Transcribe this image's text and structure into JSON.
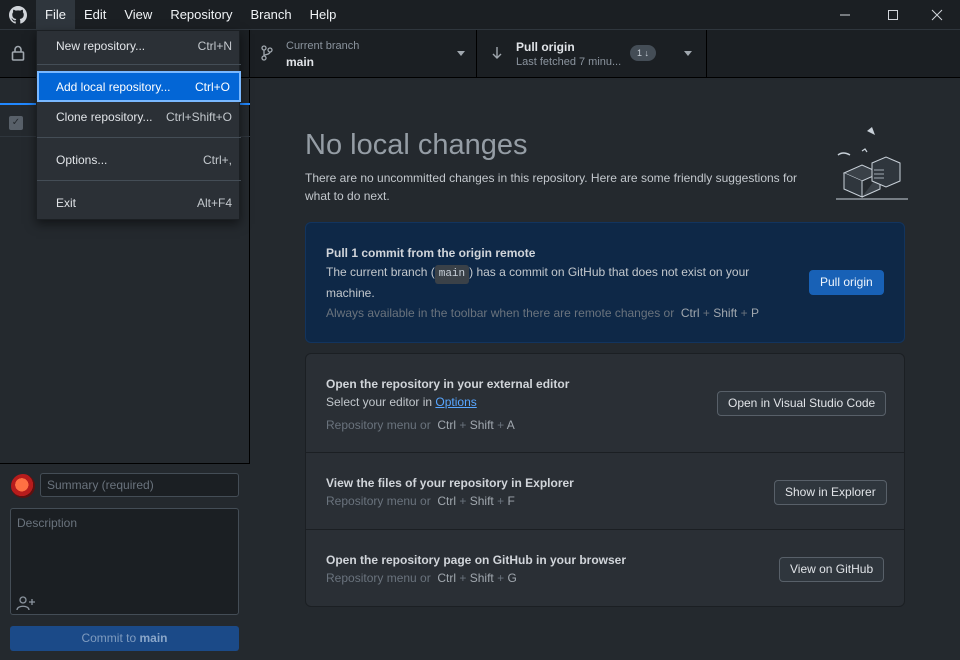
{
  "menubar": {
    "items": [
      "File",
      "Edit",
      "View",
      "Repository",
      "Branch",
      "Help"
    ],
    "active": "File"
  },
  "window_controls": {
    "minimize": "─",
    "maximize": "☐",
    "close": "✕"
  },
  "toolbar": {
    "branch": {
      "label": "Current branch",
      "value": "main"
    },
    "pull": {
      "label": "Pull origin",
      "sub": "Last fetched 7 minu...",
      "badge": "1 ↓"
    }
  },
  "file_menu": {
    "items": [
      {
        "label": "New repository...",
        "shortcut": "Ctrl+N"
      },
      {
        "label": "Add local repository...",
        "shortcut": "Ctrl+O",
        "selected": true
      },
      {
        "label": "Clone repository...",
        "shortcut": "Ctrl+Shift+O"
      },
      {
        "label": "Options...",
        "shortcut": "Ctrl+,"
      },
      {
        "label": "Exit",
        "shortcut": "Alt+F4"
      }
    ]
  },
  "commit": {
    "summary_placeholder": "Summary (required)",
    "description_placeholder": "Description",
    "button_prefix": "Commit to",
    "button_branch": "main"
  },
  "main": {
    "heading": "No local changes",
    "subtext": "There are no uncommitted changes in this repository. Here are some friendly suggestions for what to do next.",
    "pull_card": {
      "title": "Pull 1 commit from the origin remote",
      "desc_before": "The current branch (",
      "branch": "main",
      "desc_after": ") has a commit on GitHub that does not exist on your machine.",
      "hint": "Always available in the toolbar when there are remote changes or",
      "keys": [
        "Ctrl",
        "Shift",
        "P"
      ],
      "button": "Pull origin"
    },
    "editor_card": {
      "title": "Open the repository in your external editor",
      "desc": "Select your editor in",
      "link": "Options",
      "hint": "Repository menu or",
      "keys": [
        "Ctrl",
        "Shift",
        "A"
      ],
      "button": "Open in Visual Studio Code"
    },
    "explorer_card": {
      "title": "View the files of your repository in Explorer",
      "hint": "Repository menu or",
      "keys": [
        "Ctrl",
        "Shift",
        "F"
      ],
      "button": "Show in Explorer"
    },
    "github_card": {
      "title": "Open the repository page on GitHub in your browser",
      "hint": "Repository menu or",
      "keys": [
        "Ctrl",
        "Shift",
        "G"
      ],
      "button": "View on GitHub"
    }
  }
}
